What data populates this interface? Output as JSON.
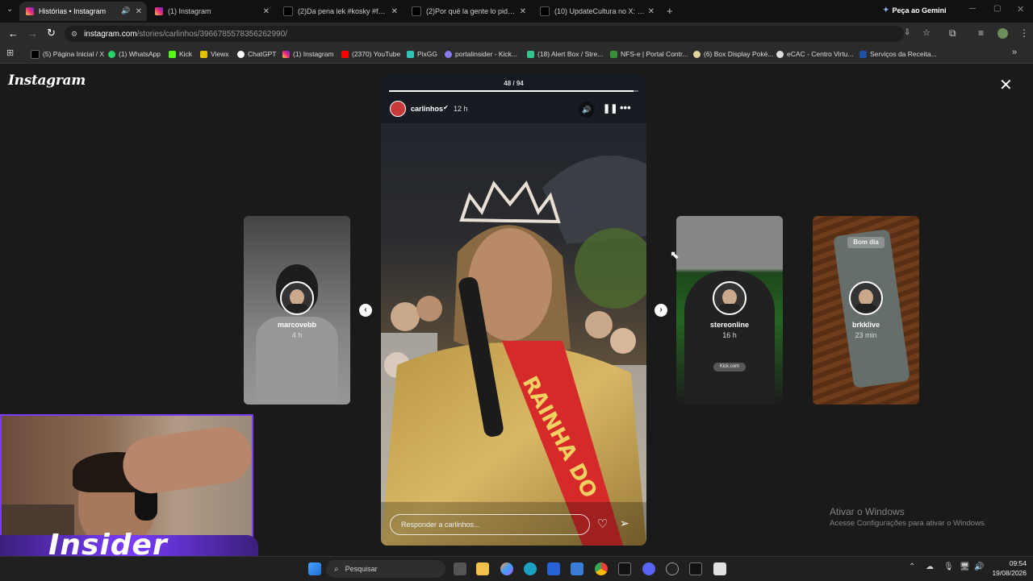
{
  "browser": {
    "tabs": [
      {
        "title": "Histórias • Instagram",
        "active": true
      },
      {
        "title": "(1) Instagram"
      },
      {
        "title": "(2)Da pena lek #kosky #fontin..."
      },
      {
        "title": "(2)Por qué la gente lo pide, Par..."
      },
      {
        "title": "(10) UpdateCultura no X: \"May..."
      }
    ],
    "gemini_label": "Peça ao Gemini",
    "url_host": "instagram.com",
    "url_path": "/stories/carlinhos/3966785578356262990/",
    "bookmarks": [
      "(5) Página Inicial / X",
      "(1) WhatsApp",
      "Kick",
      "Viewx",
      "ChatGPT",
      "(1) Instagram",
      "(2370) YouTube",
      "PixGG",
      "portalinsider - Kick...",
      "(18) Alert Box / Stre...",
      "NFS-e | Portal Contr...",
      "(6) Box Display Poké...",
      "eCAC - Centro Virtu...",
      "Serviços da Receita..."
    ]
  },
  "instagram": {
    "logo": "Instagram",
    "counter": "48 / 94",
    "story": {
      "username": "carlinhos",
      "time": "12 h",
      "reply_placeholder": "Responder a carlinhos...",
      "sash_text": "RAINHA DO"
    },
    "side_stories": [
      {
        "user": "marcovebb",
        "time": "4 h"
      },
      {
        "user": "stereonline",
        "time": "16 h",
        "badge": "Kick.com"
      },
      {
        "user": "brkklive",
        "time": "23 min",
        "sticker": "Bom dia"
      }
    ]
  },
  "windows": {
    "activate_title": "Ativar o Windows",
    "activate_sub": "Acesse Configurações para ativar o Windows.",
    "search_placeholder": "Pesquisar",
    "time": "09:54",
    "date": "19/08/2026"
  },
  "overlay": {
    "brand": "Insider"
  },
  "colors": {
    "ig_bg": "#1a1a1a",
    "accent_red": "#d62a2a",
    "webcam_border": "#7a3cff"
  }
}
